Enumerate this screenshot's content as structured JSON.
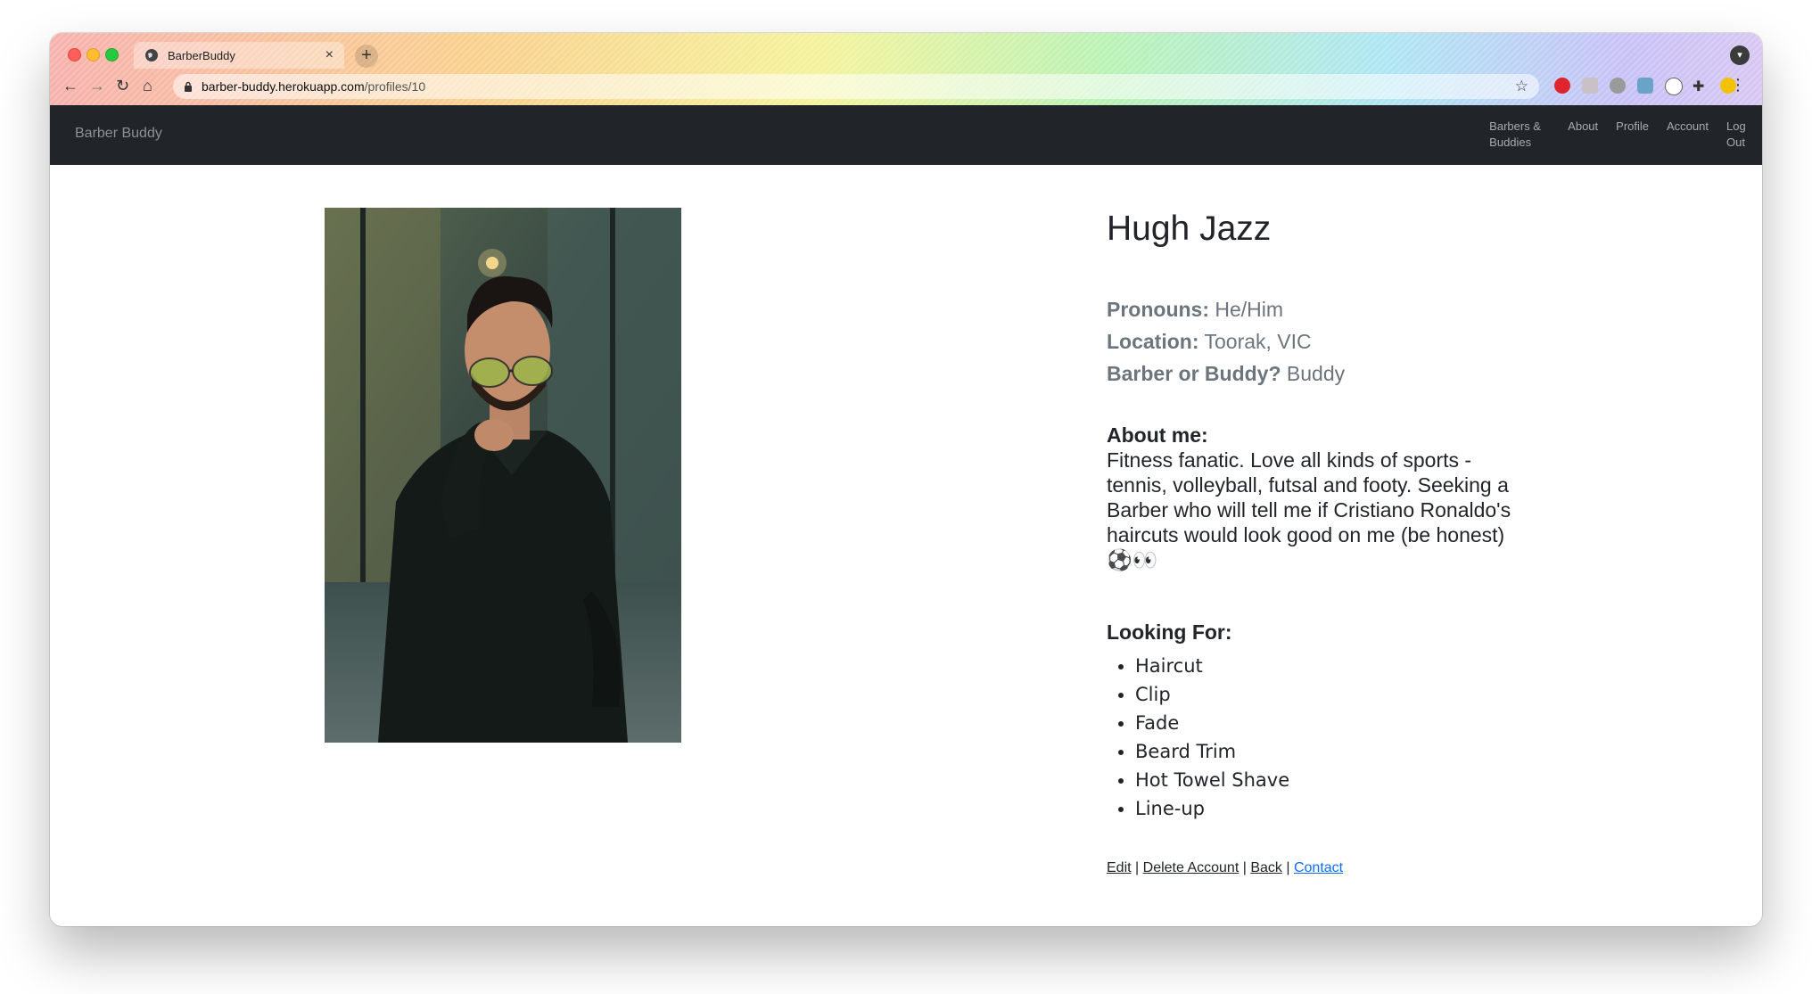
{
  "browser": {
    "tab_title": "BarberBuddy",
    "tab_close": "×",
    "new_tab": "+",
    "url_host": "barber-buddy.herokuapp.com",
    "url_path": "/profiles/10"
  },
  "navbar": {
    "brand": "Barber Buddy",
    "links": [
      "Barbers & Buddies",
      "About",
      "Profile",
      "Account",
      "Log Out"
    ]
  },
  "profile": {
    "name": "Hugh Jazz",
    "pronouns_label": "Pronouns:",
    "pronouns_value": "He/Him",
    "location_label": "Location:",
    "location_value": "Toorak, VIC",
    "role_label": "Barber or Buddy?",
    "role_value": "Buddy",
    "about_label": "About me:",
    "about_text": "Fitness fanatic. Love all kinds of sports - tennis, volleyball, futsal and footy. Seeking a Barber who will tell me if Cristiano Ronaldo's haircuts would look good on me (be honest) ⚽👀",
    "looking_label": "Looking For:",
    "looking_for": [
      "Haircut",
      "Clip",
      "Fade",
      "Beard Trim",
      "Hot Towel Shave",
      "Line-up"
    ]
  },
  "actions": {
    "edit": "Edit",
    "delete": "Delete Account",
    "back": "Back",
    "contact": "Contact",
    "separator": "|"
  },
  "colors": {
    "navbar_bg": "#212529",
    "link_blue": "#0d6efd"
  }
}
